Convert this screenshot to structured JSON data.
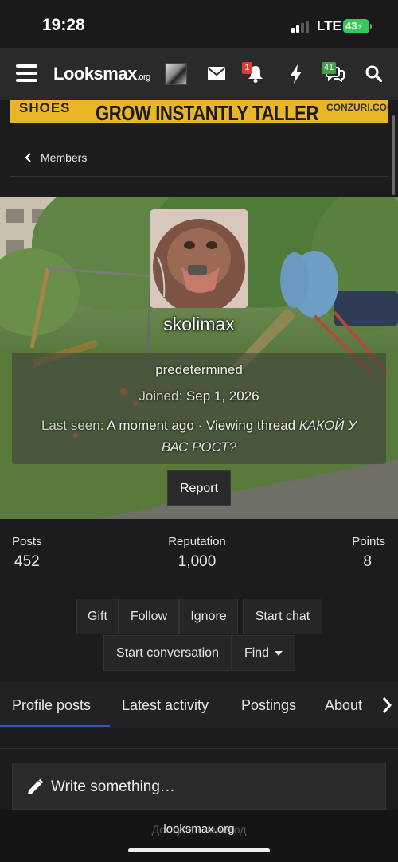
{
  "status_bar": {
    "time": "19:28",
    "network": "LTE",
    "battery": "43"
  },
  "navbar": {
    "logo_main": "Lᴏᴏksmax",
    "logo_suffix": ".org",
    "notifications_count": "1",
    "messages_count": "41",
    "icons": [
      "menu-icon",
      "mail-icon",
      "bell-icon",
      "lightning-icon",
      "chat-icon",
      "search-icon"
    ]
  },
  "banner": {
    "left_text": "SHOES",
    "main_text": "GROW INSTANTLY TALLER",
    "right_text": "CONZURI.COM"
  },
  "breadcrumb": {
    "label": "Members"
  },
  "profile": {
    "username": "skolimax",
    "title": "predetermined",
    "joined_label": "Joined:",
    "joined_value": "Sep 1, 2026",
    "last_seen_label": "Last seen:",
    "last_seen_value": "A moment ago · Viewing thread",
    "thread_title": "КАКОЙ У ВАС РОСТ?",
    "report_label": "Report"
  },
  "stats": [
    {
      "label": "Posts",
      "value": "452"
    },
    {
      "label": "Reputation",
      "value": "1,000"
    },
    {
      "label": "Points",
      "value": "8"
    }
  ],
  "actions": {
    "gift": "Gift",
    "follow": "Follow",
    "ignore": "Ignore",
    "start_chat": "Start chat",
    "start_conversation": "Start conversation",
    "find": "Find"
  },
  "tabs": [
    "Profile posts",
    "Latest activity",
    "Postings",
    "About"
  ],
  "active_tab": "Profile posts",
  "write_placeholder": "Write something…",
  "browser": {
    "url": "looksmax.org",
    "ghost_text": "Доступен перевод"
  },
  "colors": {
    "accent": "#3458a8",
    "banner": "#e9b625",
    "notification_badge": "#e03b3b",
    "message_badge": "#43a047"
  }
}
